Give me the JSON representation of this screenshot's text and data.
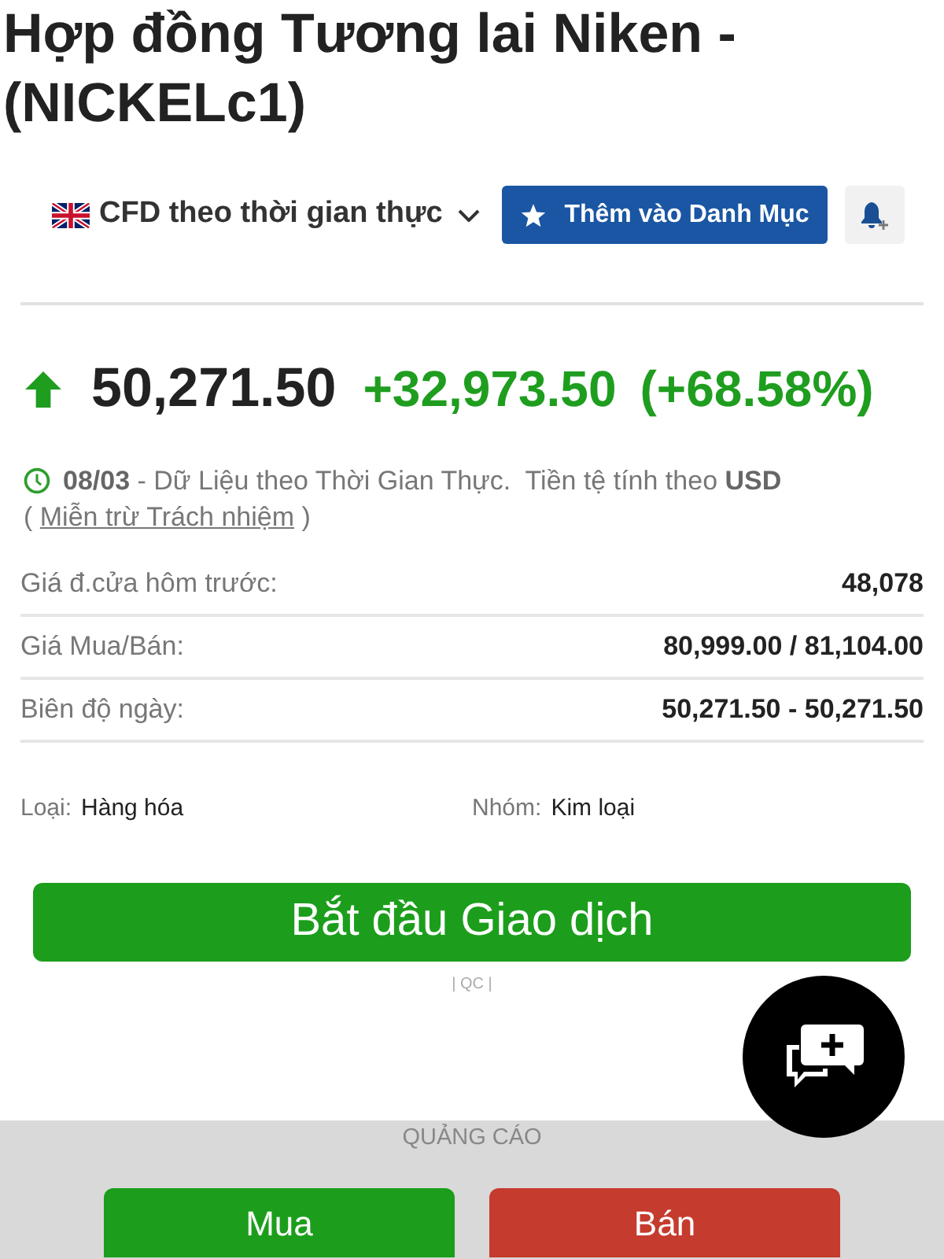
{
  "header": {
    "title": "Hợp đồng Tương lai Niken - (NICKELc1)"
  },
  "toolbar": {
    "market_selector": "CFD theo thời gian thực",
    "watchlist_button": "Thêm vào Danh Mục"
  },
  "quote": {
    "rising": true,
    "last": "50,271.50",
    "change": "+32,973.50",
    "change_percent": "(+68.58%)"
  },
  "note": {
    "text": "**08/03** - Dữ Liệu theo Thời Gian Thực.  Tiền tệ tính theo **USD**",
    "disclaimer_open": "(",
    "disclaimer_link": "Miễn trừ Trách nhiệm",
    "disclaimer_close": ")"
  },
  "stats": [
    {
      "label": "Giá đ.cửa hôm trước:",
      "value": "48,078"
    },
    {
      "label": "Giá Mua/Bán:",
      "value": "80,999.00 / 81,104.00"
    },
    {
      "label": "Biên độ ngày:",
      "value": "50,271.50 - 50,271.50"
    }
  ],
  "classification": [
    {
      "label": "Loại:",
      "value": "Hàng hóa"
    },
    {
      "label": "Nhóm:",
      "value": "Kim loại"
    }
  ],
  "trade_button": "Bắt đầu Giao dịch",
  "ad_tag": "| QC |",
  "ad_bar": {
    "label": "QUẢNG CÁO",
    "buttons": [
      {
        "label": "Mua",
        "kind": "buy"
      },
      {
        "label": "Bán",
        "kind": "sell"
      }
    ]
  }
}
